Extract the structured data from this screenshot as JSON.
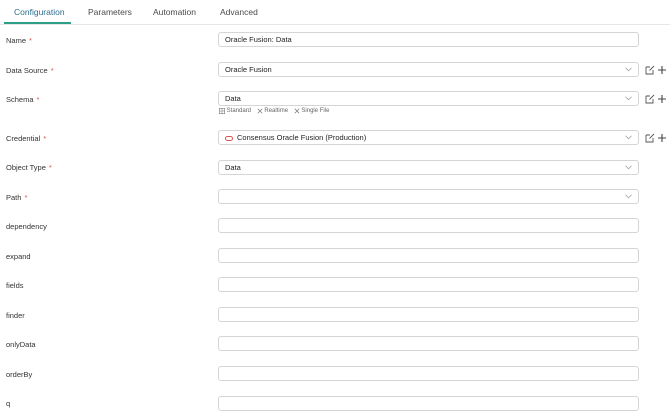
{
  "tabs": [
    {
      "label": "Configuration",
      "active": true
    },
    {
      "label": "Parameters",
      "active": false
    },
    {
      "label": "Automation",
      "active": false
    },
    {
      "label": "Advanced",
      "active": false
    }
  ],
  "form": {
    "name": {
      "label": "Name",
      "required": "*",
      "value": "Oracle Fusion: Data"
    },
    "data_source": {
      "label": "Data Source",
      "required": "*",
      "value": "Oracle Fusion"
    },
    "schema": {
      "label": "Schema",
      "required": "*",
      "value": "Data",
      "options": [
        "Standard",
        "Realtime",
        "Single File"
      ]
    },
    "credential": {
      "label": "Credential",
      "required": "*",
      "value": "Consensus Oracle Fusion (Production)"
    },
    "object_type": {
      "label": "Object Type",
      "required": "*",
      "value": "Data"
    },
    "path": {
      "label": "Path",
      "required": "*",
      "value": ""
    },
    "dependency": {
      "label": "dependency",
      "value": ""
    },
    "expand": {
      "label": "expand",
      "value": ""
    },
    "fields": {
      "label": "fields",
      "value": ""
    },
    "finder": {
      "label": "finder",
      "value": ""
    },
    "onlyData": {
      "label": "onlyData",
      "value": ""
    },
    "orderBy": {
      "label": "orderBy",
      "value": ""
    },
    "q": {
      "label": "q",
      "value": ""
    }
  },
  "colors": {
    "accent": "#2e9e86",
    "active_tab_text": "#2c6e8f",
    "required": "#d9534f"
  },
  "icons": [
    "chevron-down-icon",
    "edit-icon",
    "plus-icon",
    "grid-icon",
    "close-icon",
    "credential-icon"
  ]
}
